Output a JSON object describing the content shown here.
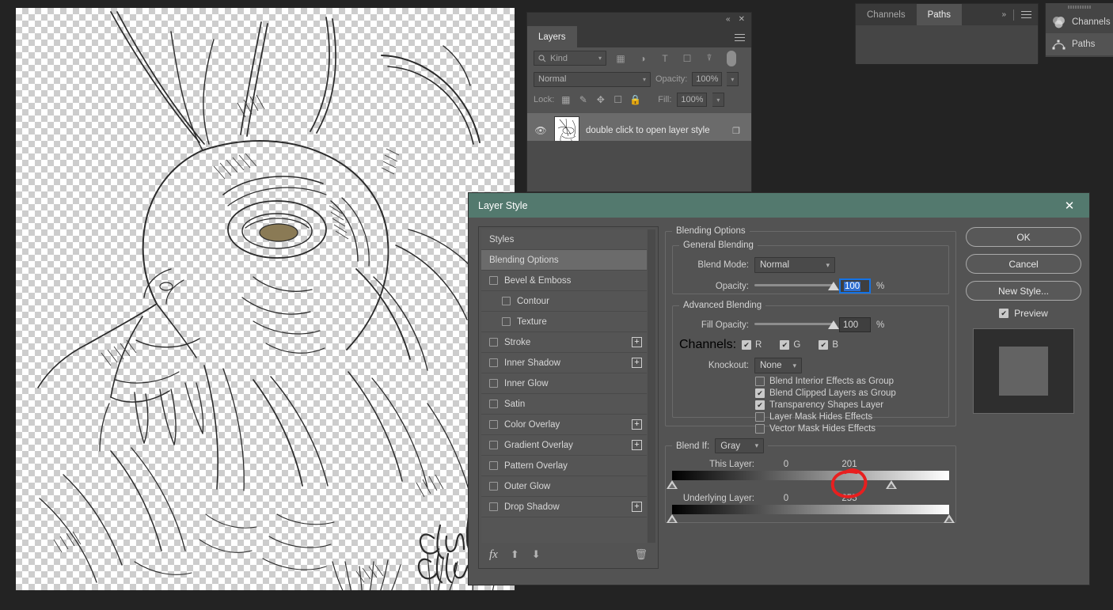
{
  "canvas": {
    "artwork_description": "ink line-art dragon head sketch",
    "signature": "Chris Allen",
    "transparency_checker": true
  },
  "layers_panel": {
    "tab_label": "Layers",
    "collapse_icon": "«",
    "close_icon": "✕",
    "filter": {
      "label": "Kind",
      "search_icon": "search-icon"
    },
    "filter_icons": [
      "image-filter-icon",
      "adjustment-filter-icon",
      "type-filter-icon",
      "shape-filter-icon",
      "smartobject-filter-icon"
    ],
    "blend_mode": "Normal",
    "opacity_label": "Opacity:",
    "opacity_value": "100%",
    "lock_label": "Lock:",
    "lock_icons": [
      "lock-transparency-icon",
      "lock-image-icon",
      "lock-position-icon",
      "lock-artboard-icon",
      "lock-all-icon"
    ],
    "fill_label": "Fill:",
    "fill_value": "100%",
    "layer": {
      "name": "double click to open layer style",
      "eye_icon": "visibility-eye-icon",
      "link_icon": "layer-effects-icon"
    }
  },
  "channels_panel": {
    "tabs": [
      {
        "label": "Channels",
        "active": false
      },
      {
        "label": "Paths",
        "active": true
      }
    ],
    "expand_icon": "»"
  },
  "icon_dock": {
    "items": [
      {
        "label": "Channels",
        "icon": "channels-icon",
        "active": false
      },
      {
        "label": "Paths",
        "icon": "paths-icon",
        "active": true
      }
    ]
  },
  "dialog": {
    "title": "Layer Style",
    "close_icon": "✕",
    "styles_list": [
      {
        "label": "Styles",
        "checkbox": false,
        "checked": false,
        "plus": false,
        "selected": false,
        "indent": false
      },
      {
        "label": "Blending Options",
        "checkbox": false,
        "checked": false,
        "plus": false,
        "selected": true,
        "indent": false
      },
      {
        "label": "Bevel & Emboss",
        "checkbox": true,
        "checked": false,
        "plus": false,
        "selected": false,
        "indent": false
      },
      {
        "label": "Contour",
        "checkbox": true,
        "checked": false,
        "plus": false,
        "selected": false,
        "indent": true
      },
      {
        "label": "Texture",
        "checkbox": true,
        "checked": false,
        "plus": false,
        "selected": false,
        "indent": true
      },
      {
        "label": "Stroke",
        "checkbox": true,
        "checked": false,
        "plus": true,
        "selected": false,
        "indent": false
      },
      {
        "label": "Inner Shadow",
        "checkbox": true,
        "checked": false,
        "plus": true,
        "selected": false,
        "indent": false
      },
      {
        "label": "Inner Glow",
        "checkbox": true,
        "checked": false,
        "plus": false,
        "selected": false,
        "indent": false
      },
      {
        "label": "Satin",
        "checkbox": true,
        "checked": false,
        "plus": false,
        "selected": false,
        "indent": false
      },
      {
        "label": "Color Overlay",
        "checkbox": true,
        "checked": false,
        "plus": true,
        "selected": false,
        "indent": false
      },
      {
        "label": "Gradient Overlay",
        "checkbox": true,
        "checked": false,
        "plus": true,
        "selected": false,
        "indent": false
      },
      {
        "label": "Pattern Overlay",
        "checkbox": true,
        "checked": false,
        "plus": false,
        "selected": false,
        "indent": false
      },
      {
        "label": "Outer Glow",
        "checkbox": true,
        "checked": false,
        "plus": false,
        "selected": false,
        "indent": false
      },
      {
        "label": "Drop Shadow",
        "checkbox": true,
        "checked": false,
        "plus": true,
        "selected": false,
        "indent": false
      }
    ],
    "styles_footer": {
      "fx_label": "fx",
      "up_icon": "arrow-up-icon",
      "down_icon": "arrow-down-icon",
      "trash_icon": "trash-icon"
    },
    "blending_options": {
      "legend": "Blending Options",
      "general": {
        "legend": "General Blending",
        "blend_mode_label": "Blend Mode:",
        "blend_mode_value": "Normal",
        "opacity_label": "Opacity:",
        "opacity_value": "100",
        "opacity_unit": "%",
        "opacity_slider_pct": 100
      },
      "advanced": {
        "legend": "Advanced Blending",
        "fill_opacity_label": "Fill Opacity:",
        "fill_opacity_value": "100",
        "fill_opacity_unit": "%",
        "fill_opacity_slider_pct": 100,
        "channels_label": "Channels:",
        "channels": [
          {
            "label": "R",
            "checked": true
          },
          {
            "label": "G",
            "checked": true
          },
          {
            "label": "B",
            "checked": true
          }
        ],
        "knockout_label": "Knockout:",
        "knockout_value": "None",
        "checkboxes": [
          {
            "label": "Blend Interior Effects as Group",
            "checked": false
          },
          {
            "label": "Blend Clipped Layers as Group",
            "checked": true
          },
          {
            "label": "Transparency Shapes Layer",
            "checked": true
          },
          {
            "label": "Layer Mask Hides Effects",
            "checked": false
          },
          {
            "label": "Vector Mask Hides Effects",
            "checked": false
          }
        ]
      },
      "blend_if": {
        "label": "Blend If:",
        "channel_value": "Gray",
        "this_layer": {
          "label": "This Layer:",
          "black_value": "0",
          "white_value": "201",
          "black_pct": 0,
          "white_pct": 79
        },
        "underlying_layer": {
          "label": "Underlying Layer:",
          "black_value": "0",
          "white_value": "255",
          "black_pct": 0,
          "white_pct": 100
        }
      }
    },
    "buttons": {
      "ok": "OK",
      "cancel": "Cancel",
      "new_style": "New Style...",
      "preview_label": "Preview",
      "preview_checked": true
    }
  },
  "annotation": {
    "shape": "red-circle-highlight",
    "color": "#e81f1f",
    "target": "this-layer-white-slider-handle"
  }
}
